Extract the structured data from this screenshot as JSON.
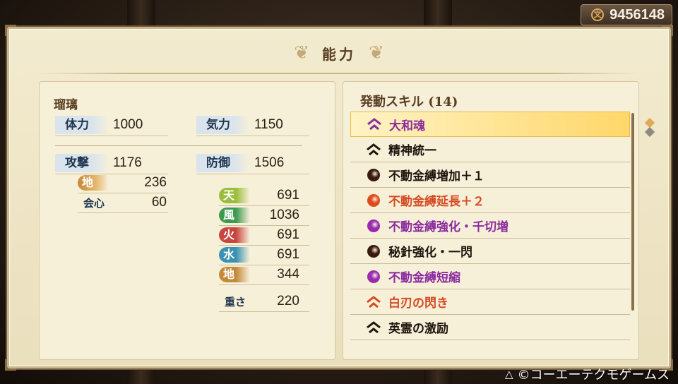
{
  "money": {
    "amount": "9456148",
    "icon": "mon-coin-icon"
  },
  "panel": {
    "title": "能力"
  },
  "character": {
    "name": "瑠璃"
  },
  "stats": {
    "hp_label": "体力",
    "hp": "1000",
    "ki_label": "気力",
    "ki": "1150",
    "atk_label": "攻撃",
    "atk": "1176",
    "def_label": "防御",
    "def": "1506",
    "earth_atk_label": "地",
    "earth_atk": "236",
    "crit_label": "会心",
    "crit": "60",
    "weight_label": "重さ",
    "weight": "220"
  },
  "resist": [
    {
      "label": "天",
      "value": "691",
      "color": "#9bbd3a"
    },
    {
      "label": "風",
      "value": "1036",
      "color": "#3e9a4e"
    },
    {
      "label": "火",
      "value": "691",
      "color": "#c8463f"
    },
    {
      "label": "水",
      "value": "691",
      "color": "#3a92b0"
    },
    {
      "label": "地",
      "value": "344",
      "color": "#c48a3a"
    }
  ],
  "skills": {
    "header": "発動スキル (14)",
    "items": [
      {
        "label": "大和魂",
        "color": "#8a2a9e",
        "icon": "chevron-icon",
        "icon_color": "#8a2a9e"
      },
      {
        "label": "精神統一",
        "color": "#1e140c",
        "icon": "chevron-icon",
        "icon_color": "#1e140c"
      },
      {
        "label": "不動金縛増加＋１",
        "color": "#1e140c",
        "icon": "orb-icon",
        "icon_color": "#3a1a0c"
      },
      {
        "label": "不動金縛延長＋２",
        "color": "#d64a22",
        "icon": "orb-icon",
        "icon_color": "#e04a1a"
      },
      {
        "label": "不動金縛強化・千切増",
        "color": "#8a2a9e",
        "icon": "orb-icon",
        "icon_color": "#9a2aae"
      },
      {
        "label": "秘針強化・一閃",
        "color": "#1e140c",
        "icon": "orb-icon",
        "icon_color": "#3a1a0c"
      },
      {
        "label": "不動金縛短縮",
        "color": "#8a2a9e",
        "icon": "orb-icon",
        "icon_color": "#9a2aae"
      },
      {
        "label": "白刃の閃き",
        "color": "#d64a22",
        "icon": "chevron-icon",
        "icon_color": "#d64a22"
      },
      {
        "label": "英霊の激励",
        "color": "#1e140c",
        "icon": "chevron-icon",
        "icon_color": "#1e140c"
      }
    ]
  },
  "copyright": "©コーエーテクモゲームス",
  "badge_colors": {
    "earth": "#c48a3a"
  }
}
